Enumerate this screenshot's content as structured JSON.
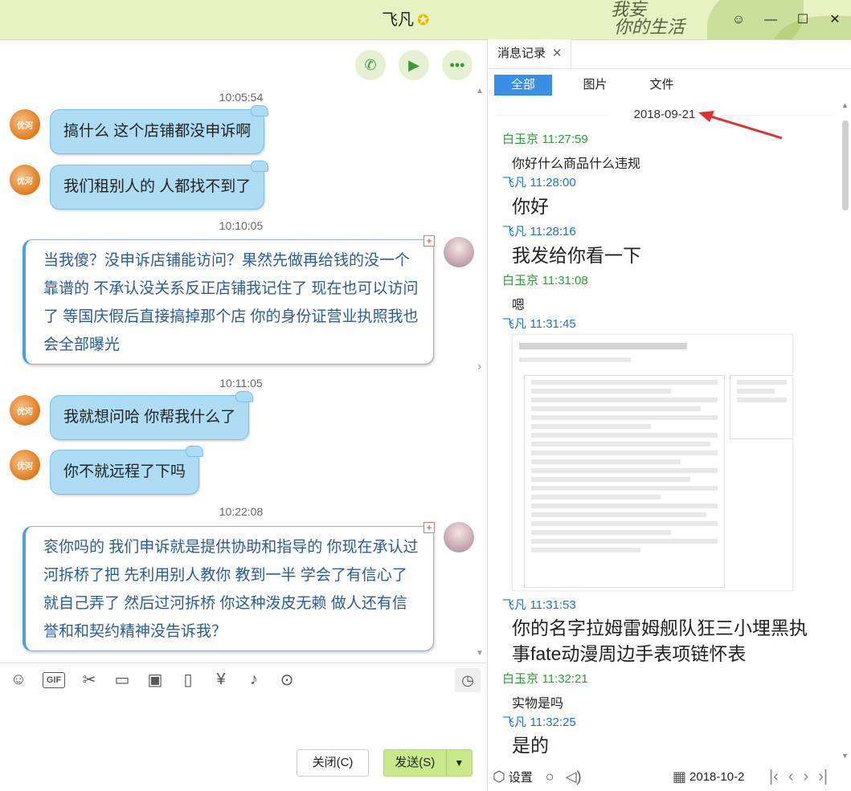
{
  "window": {
    "title": "飞凡",
    "decor_line1": "我妄",
    "decor_line2": "你的生活"
  },
  "chat": {
    "messages": [
      {
        "type": "time",
        "text": "10:05:54"
      },
      {
        "type": "in",
        "text": "搞什么  这个店铺都没申诉啊"
      },
      {
        "type": "in",
        "text": "我们租别人的  人都找不到了"
      },
      {
        "type": "time",
        "text": "10:10:05"
      },
      {
        "type": "out",
        "text": "当我傻？没申诉店铺能访问？果然先做再给钱的没一个靠谱的     不承认没关系反正店铺我记住了 现在也可以访问了  等国庆假后直接搞掉那个店  你的身份证营业执照我也会全部曝光"
      },
      {
        "type": "time",
        "text": "10:11:05"
      },
      {
        "type": "in",
        "text": "我就想问哈 你帮我什么了"
      },
      {
        "type": "in",
        "text": "你不就远程了下吗"
      },
      {
        "type": "time",
        "text": "10:22:08"
      },
      {
        "type": "out",
        "text": "衮你吗的  我们申诉就是提供协助和指导的     你现在承认过河拆桥了把      先利用别人教你  教到一半  学会了有信心了 就自己弄了  然后过河拆桥    你这种泼皮无赖 做人还有信誉和和契约精神没告诉我？"
      }
    ],
    "avatar_text": "优河",
    "close_label": "关闭(C)",
    "send_label": "发送(S)"
  },
  "history": {
    "tab_label": "消息记录",
    "filters": [
      "全部",
      "图片",
      "文件"
    ],
    "date": "2018-09-21",
    "entries": [
      {
        "sender": "白玉京",
        "time": "11:27:59",
        "text": "你好什么商品什么违规"
      },
      {
        "sender": "飞凡",
        "time": "11:28:00",
        "text": "你好"
      },
      {
        "sender": "飞凡",
        "time": "11:28:16",
        "text": "我发给你看一下"
      },
      {
        "sender": "白玉京",
        "time": "11:31:08",
        "text": "嗯"
      },
      {
        "sender": "飞凡",
        "time": "11:31:45",
        "text": ""
      },
      {
        "sender": "飞凡",
        "time": "11:31:53",
        "text": "你的名字拉姆雷姆舰队狂三小埋黑执事fate动漫周边手表项链怀表"
      },
      {
        "sender": "白玉京",
        "time": "11:32:21",
        "text": "实物是吗"
      },
      {
        "sender": "飞凡",
        "time": "11:32:25",
        "text": "是的"
      }
    ],
    "footer": {
      "settings": "设置",
      "date": "2018-10-2"
    }
  }
}
